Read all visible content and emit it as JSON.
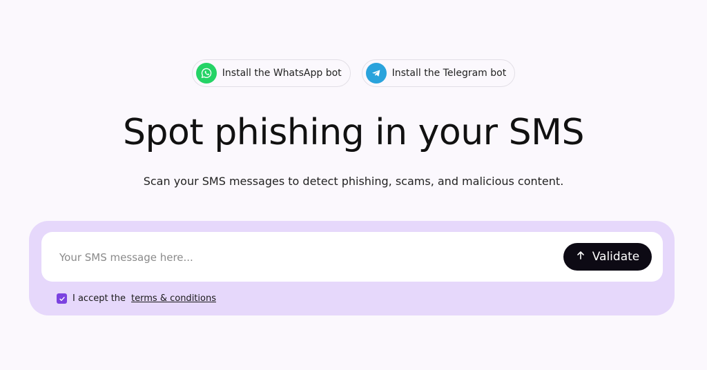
{
  "bots": {
    "whatsapp": {
      "label": "Install the WhatsApp bot",
      "icon": "whatsapp-icon",
      "color": "#25d366"
    },
    "telegram": {
      "label": "Install the Telegram bot",
      "icon": "telegram-icon",
      "color": "#2aa3dc"
    }
  },
  "hero": {
    "title": "Spot phishing in your SMS",
    "subtitle": "Scan your SMS messages to detect phishing, scams, and malicious content."
  },
  "form": {
    "input_placeholder": "Your SMS message here...",
    "input_value": "",
    "validate_label": "Validate",
    "validate_icon": "arrow-up-icon",
    "terms_prefix": "I accept the",
    "terms_link": "terms & conditions",
    "terms_checked": true
  },
  "colors": {
    "background": "#fbf8fd",
    "panel": "#e6d8fb",
    "accent": "#7b42e0",
    "button": "#0d0a14"
  }
}
